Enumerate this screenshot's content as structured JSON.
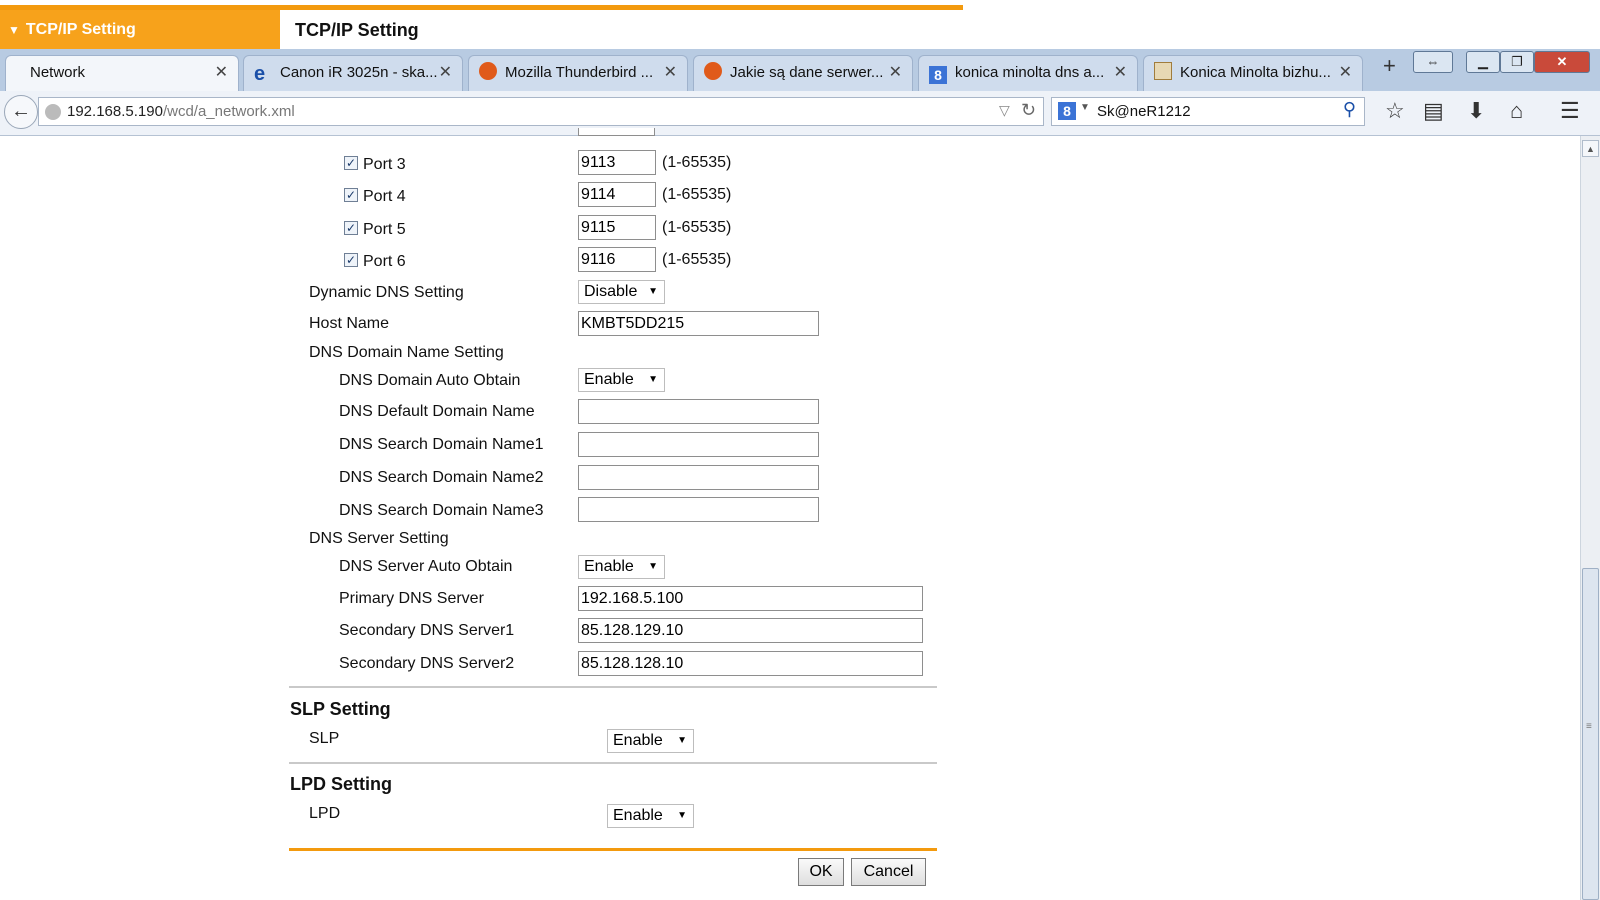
{
  "page_header": {
    "left_tab_label": "TCP/IP Setting",
    "title": "TCP/IP Setting"
  },
  "browser": {
    "tabs": [
      {
        "label": "Network",
        "icon": "none"
      },
      {
        "label": "Canon iR 3025n - ska...",
        "icon": "ie-icon"
      },
      {
        "label": "Mozilla Thunderbird ...",
        "icon": "thunderbird-icon"
      },
      {
        "label": "Jakie są dane serwer...",
        "icon": "thunderbird-icon"
      },
      {
        "label": "konica minolta dns a...",
        "icon": "google-icon"
      },
      {
        "label": "Konica Minolta bizhu...",
        "icon": "konica-icon"
      }
    ],
    "url_host": "192.168.5.190",
    "url_path": "/wcd/a_network.xml",
    "search_text": "Sk@neR1212"
  },
  "ports": [
    {
      "label": "Port 3",
      "checked": true,
      "value": "9113",
      "range": "(1-65535)"
    },
    {
      "label": "Port 4",
      "checked": true,
      "value": "9114",
      "range": "(1-65535)"
    },
    {
      "label": "Port 5",
      "checked": true,
      "value": "9115",
      "range": "(1-65535)"
    },
    {
      "label": "Port 6",
      "checked": true,
      "value": "9116",
      "range": "(1-65535)"
    }
  ],
  "dynamic_dns": {
    "label": "Dynamic DNS Setting",
    "value": "Disable"
  },
  "host_name": {
    "label": "Host Name",
    "value": "KMBT5DD215"
  },
  "dns_domain": {
    "heading": "DNS Domain Name Setting",
    "auto_obtain": {
      "label": "DNS Domain Auto Obtain",
      "value": "Enable"
    },
    "default_domain": {
      "label": "DNS Default Domain Name",
      "value": ""
    },
    "search1": {
      "label": "DNS Search Domain Name1",
      "value": ""
    },
    "search2": {
      "label": "DNS Search Domain Name2",
      "value": ""
    },
    "search3": {
      "label": "DNS Search Domain Name3",
      "value": ""
    }
  },
  "dns_server": {
    "heading": "DNS Server Setting",
    "auto_obtain": {
      "label": "DNS Server Auto Obtain",
      "value": "Enable"
    },
    "primary": {
      "label": "Primary DNS Server",
      "value": "192.168.5.100"
    },
    "secondary1": {
      "label": "Secondary DNS Server1",
      "value": "85.128.129.10"
    },
    "secondary2": {
      "label": "Secondary DNS Server2",
      "value": "85.128.128.10"
    }
  },
  "slp": {
    "heading": "SLP Setting",
    "label": "SLP",
    "value": "Enable"
  },
  "lpd": {
    "heading": "LPD Setting",
    "label": "LPD",
    "value": "Enable"
  },
  "buttons": {
    "ok": "OK",
    "cancel": "Cancel"
  },
  "glyphs": {
    "close": "✕",
    "check": "✓",
    "dropdown": "▼",
    "new_tab": "+",
    "back": "🡐",
    "triangle": "▼"
  }
}
